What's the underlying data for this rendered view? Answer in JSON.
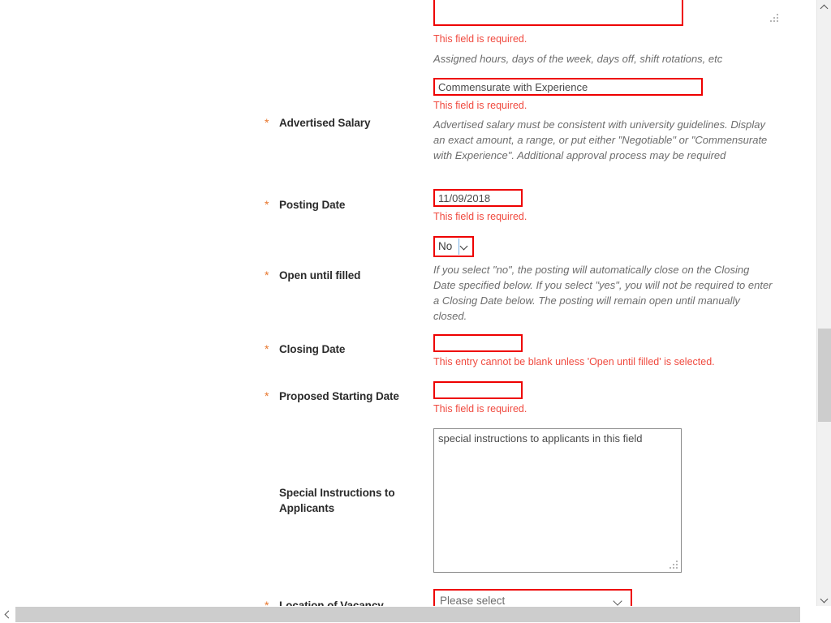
{
  "form": {
    "rows": [
      {
        "id": "work-schedule",
        "label": "",
        "required": false,
        "textarea_value": "",
        "error": "This field is required.",
        "help": "Assigned hours, days of the week, days off, shift rotations, etc"
      },
      {
        "id": "advertised-salary",
        "label": "Advertised Salary",
        "required": true,
        "value": "Commensurate with Experience",
        "error": "This field is required.",
        "help": "Advertised salary must be consistent with university guidelines. Display an exact amount, a range, or put either \"Negotiable\" or \"Commensurate with Experience\". Additional approval process may be required"
      },
      {
        "id": "posting-date",
        "label": "Posting Date",
        "required": true,
        "value": "11/09/2018",
        "error": "This field is required.",
        "help": ""
      },
      {
        "id": "open-until-filled",
        "label": "Open until filled",
        "required": true,
        "value": "No",
        "error": "",
        "help": "If you select \"no\", the posting will automatically close on the Closing Date specified below. If you select \"yes\", you will not be required to enter a Closing Date below. The posting will remain open until manually closed."
      },
      {
        "id": "closing-date",
        "label": "Closing Date",
        "required": true,
        "value": "",
        "error": "This entry cannot be blank unless 'Open until filled' is selected.",
        "help": ""
      },
      {
        "id": "proposed-starting-date",
        "label": "Proposed Starting Date",
        "required": true,
        "value": "",
        "error": "This field is required.",
        "help": ""
      },
      {
        "id": "special-instructions",
        "label_line1": "Special Instructions to",
        "label_line2": "Applicants",
        "required": false,
        "textarea_value": "special instructions to applicants in this field",
        "error": "",
        "help": ""
      },
      {
        "id": "location-of-vacancy",
        "label": "Location of Vacancy",
        "required": true,
        "value": "Please select",
        "error": "",
        "help": ""
      }
    ],
    "required_marker": "*"
  },
  "colors": {
    "error_border": "#ee0000",
    "error_text": "#f04a3f",
    "required_star": "#e8762c",
    "label_text": "#2b2b2b",
    "help_text": "#6d6d6d",
    "scrollbar_track": "#f1f1f1",
    "scrollbar_thumb": "#cdcdcd"
  },
  "scrollbars": {
    "vertical": {
      "up_arrow": "chevron-up",
      "down_arrow": "chevron-down"
    },
    "horizontal": {
      "left_arrow": "chevron-left",
      "right_arrow": "chevron-right"
    }
  }
}
